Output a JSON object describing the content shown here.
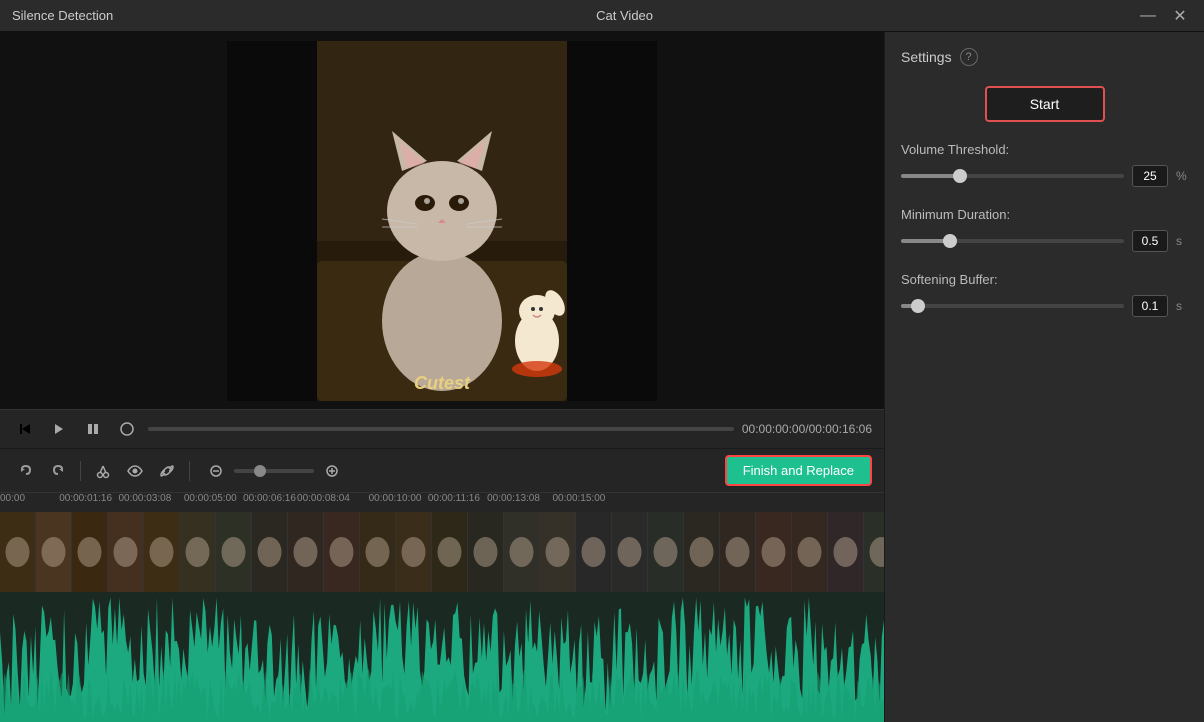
{
  "window": {
    "app_title": "Silence Detection",
    "file_title": "Cat Video"
  },
  "titlebar": {
    "minimize_label": "—",
    "close_label": "✕"
  },
  "video": {
    "overlay_text": "Cutest",
    "time_current": "00:00:00:00",
    "time_total": "00:00:16:06",
    "time_display": "00:00:00:00/00:00:16:06"
  },
  "controls": {
    "back_to_start": "⏮",
    "play_pause": "▶",
    "loop": "⟳",
    "stop": "⏹",
    "record": "⏺"
  },
  "toolbar": {
    "undo": "↩",
    "redo": "↪",
    "cut": "✂",
    "eye": "👁",
    "link": "🔗",
    "minus": "−",
    "plus": "+",
    "finish_replace": "Finish and Replace"
  },
  "timecodes": [
    "00:00",
    "00:00:01:16",
    "00:00:03:08",
    "00:00:05:00",
    "00:00:06:16",
    "00:00:08:04",
    "00:00:10:00",
    "00:00:11:16",
    "00:00:13:08",
    "00:00:15:00"
  ],
  "settings": {
    "title": "Settings",
    "help_icon": "?",
    "start_label": "Start",
    "volume_threshold_label": "Volume Threshold:",
    "volume_threshold_value": "25",
    "volume_threshold_unit": "%",
    "volume_slider_pct": 25,
    "minimum_duration_label": "Minimum Duration:",
    "minimum_duration_value": "0.5",
    "minimum_duration_unit": "s",
    "minimum_slider_pct": 20,
    "softening_buffer_label": "Softening Buffer:",
    "softening_buffer_value": "0.1",
    "softening_buffer_unit": "s",
    "softening_slider_pct": 5
  }
}
